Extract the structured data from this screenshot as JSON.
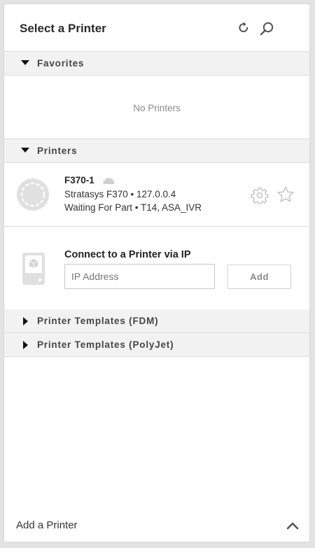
{
  "header": {
    "title": "Select a Printer",
    "refresh_icon": "refresh-icon",
    "search_icon": "search-icon"
  },
  "favorites": {
    "label": "Favorites",
    "expanded": true,
    "empty_text": "No Printers"
  },
  "printers": {
    "label": "Printers",
    "expanded": true,
    "items": [
      {
        "name": "F370-1",
        "cloud_icon": "cloud-icon",
        "line1": "Stratasys F370 • 127.0.0.4",
        "line2": "Waiting For Part • T14, ASA_IVR",
        "settings_icon": "gear-icon",
        "favorite_icon": "star-icon"
      }
    ]
  },
  "connect": {
    "title": "Connect to a Printer via IP",
    "input_placeholder": "IP Address",
    "input_value": "",
    "add_label": "Add"
  },
  "templates": [
    {
      "label": "Printer Templates (FDM)",
      "expanded": false
    },
    {
      "label": "Printer Templates (PolyJet)",
      "expanded": false
    }
  ],
  "footer": {
    "label": "Add a Printer",
    "chevron_icon": "chevron-up-icon"
  },
  "colors": {
    "background": "#e3e3e3",
    "panel": "#ffffff",
    "section_header": "#f2f2f2",
    "divider": "#dcdcdc",
    "muted_text": "#8a8a8a",
    "icon_gray": "#bdbdbd"
  }
}
